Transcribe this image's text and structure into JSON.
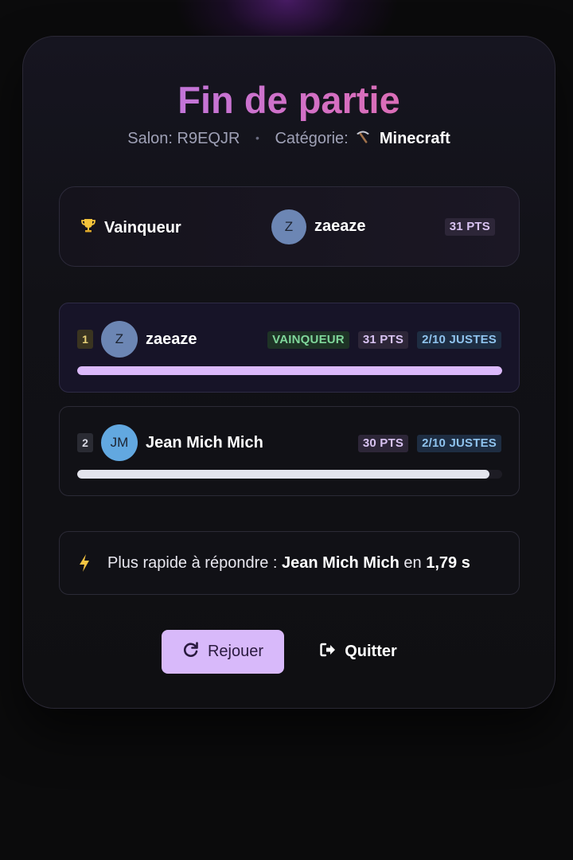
{
  "header": {
    "title": "Fin de partie",
    "room_label": "Salon:",
    "room_code": "R9EQJR",
    "separator": "•",
    "category_label": "Catégorie:",
    "category_icon": "pickaxe-icon",
    "category_name": "Minecraft"
  },
  "winner": {
    "label": "Vainqueur",
    "icon": "trophy-icon",
    "avatar_initials": "Z",
    "name": "zaeaze",
    "points": "31 PTS"
  },
  "players": [
    {
      "rank": "1",
      "initials": "Z",
      "name": "zaeaze",
      "winner_badge": "VAINQUEUR",
      "points": "31 PTS",
      "correct": "2/10 JUSTES",
      "progress": 1.0
    },
    {
      "rank": "2",
      "initials": "JM",
      "name": "Jean Mich Mich",
      "points": "30 PTS",
      "correct": "2/10 JUSTES",
      "progress": 0.97
    }
  ],
  "fastest": {
    "icon": "bolt-icon",
    "label": "Plus rapide à répondre :",
    "player": "Jean Mich Mich",
    "connector": "en",
    "time": "1,79 s"
  },
  "actions": {
    "replay_label": "Rejouer",
    "quit_label": "Quitter"
  },
  "colors": {
    "accent": "#d8b9fa",
    "title_gradient_start": "#b07cf0",
    "title_gradient_end": "#e96a9e",
    "win_badge": "#7fd69a"
  }
}
